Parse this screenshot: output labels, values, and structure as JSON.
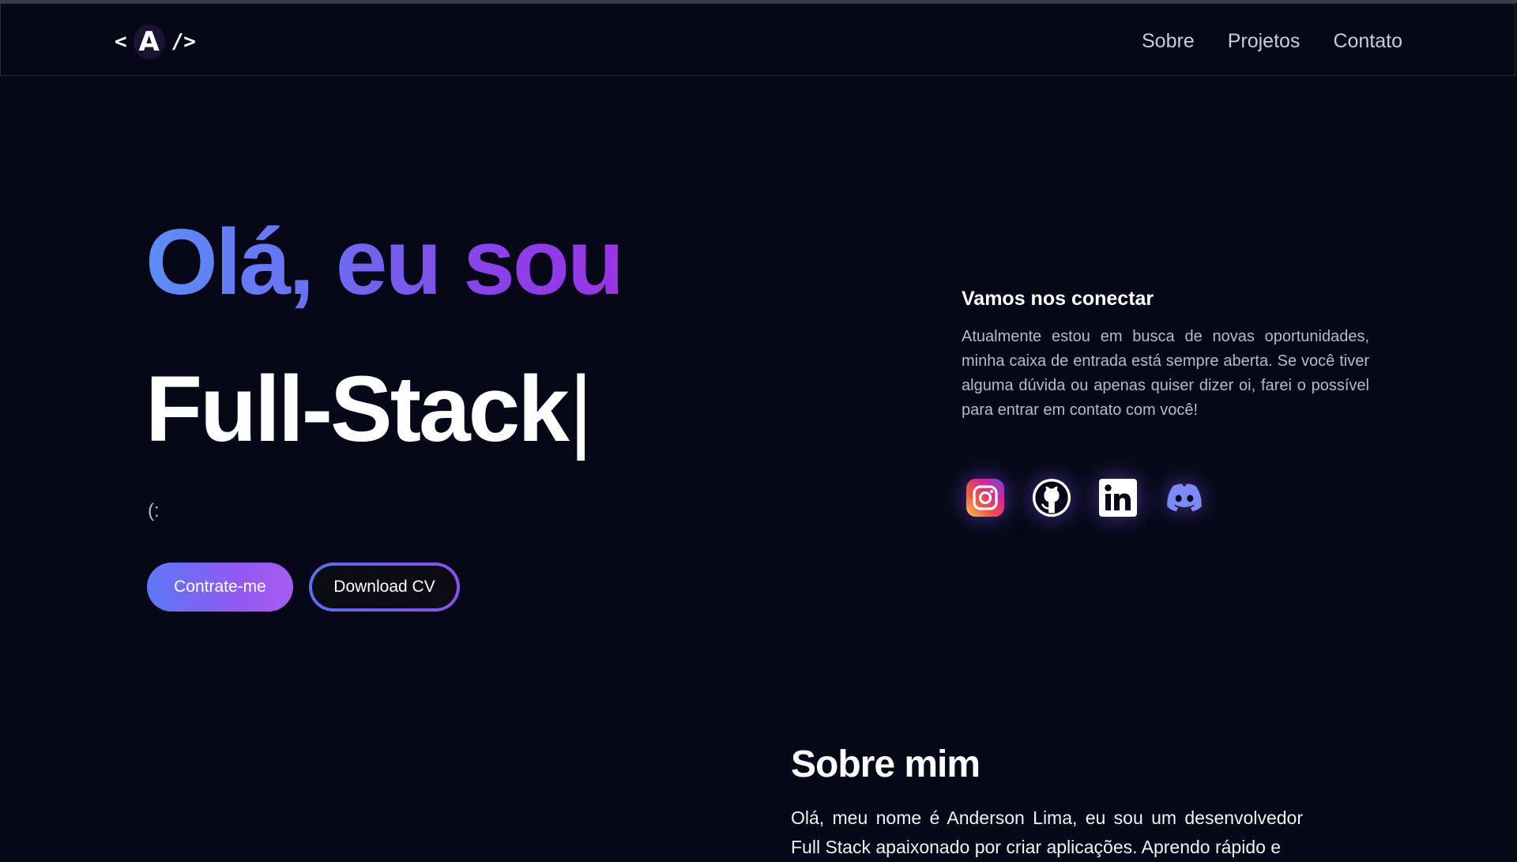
{
  "header": {
    "logo": {
      "open": "<",
      "letter": "A",
      "close": "/>"
    },
    "nav": [
      "Sobre",
      "Projetos",
      "Contato"
    ]
  },
  "hero": {
    "greeting": "Olá, eu sou",
    "role": "Full-Stack",
    "cursor": "|",
    "smile": "(:",
    "buttons": {
      "hire": "Contrate-me",
      "download": "Download CV"
    }
  },
  "connect": {
    "title": "Vamos nos conectar",
    "text": "Atualmente estou em busca de novas oportunidades, minha caixa de entrada está sempre aberta. Se você tiver alguma dúvida ou apenas quiser dizer oi, farei o possível para entrar em contato com você!",
    "socials": [
      "instagram-icon",
      "github-icon",
      "linkedin-icon",
      "discord-icon"
    ]
  },
  "about": {
    "title": "Sobre mim",
    "text": "Olá, meu nome é Anderson Lima, eu sou um desenvolvedor Full Stack apaixonado por criar aplicações. Aprendo rápido e"
  },
  "colors": {
    "background": "#070817",
    "gradient_start": "#5c8df7",
    "gradient_end": "#9a35e6",
    "discord": "#7289da"
  }
}
